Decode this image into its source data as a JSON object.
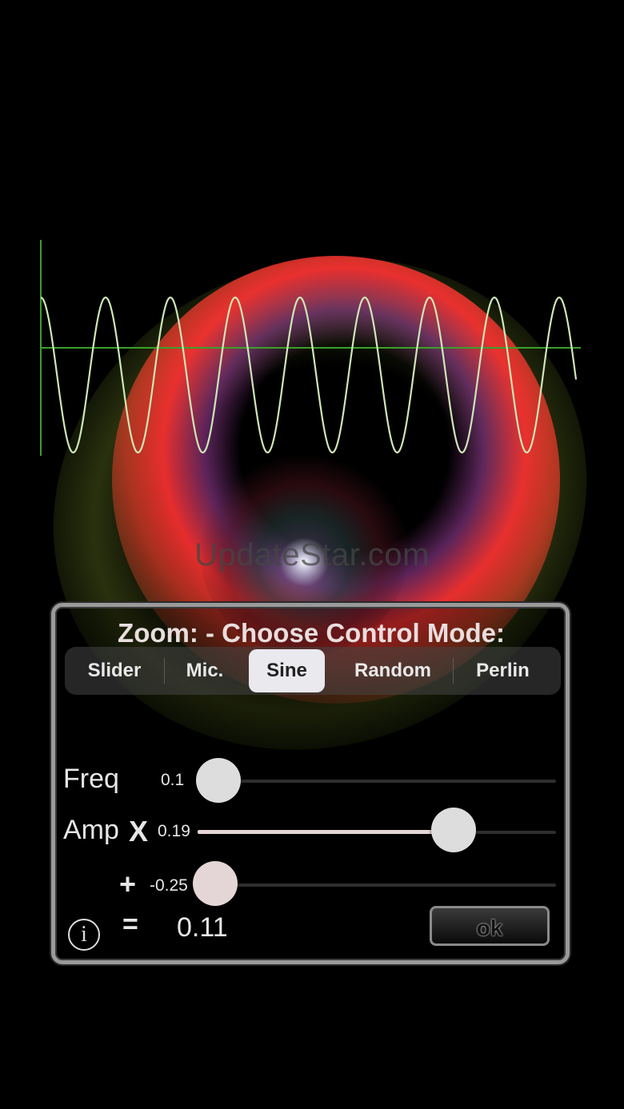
{
  "watermark": "UpdateStar.com",
  "dialog": {
    "title": "Zoom: - Choose Control Mode:",
    "modes": [
      "Slider",
      "Mic.",
      "Sine",
      "Random",
      "Perlin"
    ],
    "selected_mode": "Sine",
    "freq": {
      "label": "Freq",
      "value": "0.1",
      "level": 0.0
    },
    "amp": {
      "label": "Amp",
      "operator": "X",
      "value": "0.19",
      "level": 0.72
    },
    "offset": {
      "operator": "+",
      "value": "-0.25",
      "level": 0.0
    },
    "equals": "=",
    "result": "0.11",
    "ok_label": "ok",
    "info_glyph": "i"
  },
  "icons": {
    "info": "info-icon"
  },
  "colors": {
    "wave": "#cfe6b6",
    "axis": "#3aa02a",
    "selected_segment": "#e9e9ee"
  }
}
